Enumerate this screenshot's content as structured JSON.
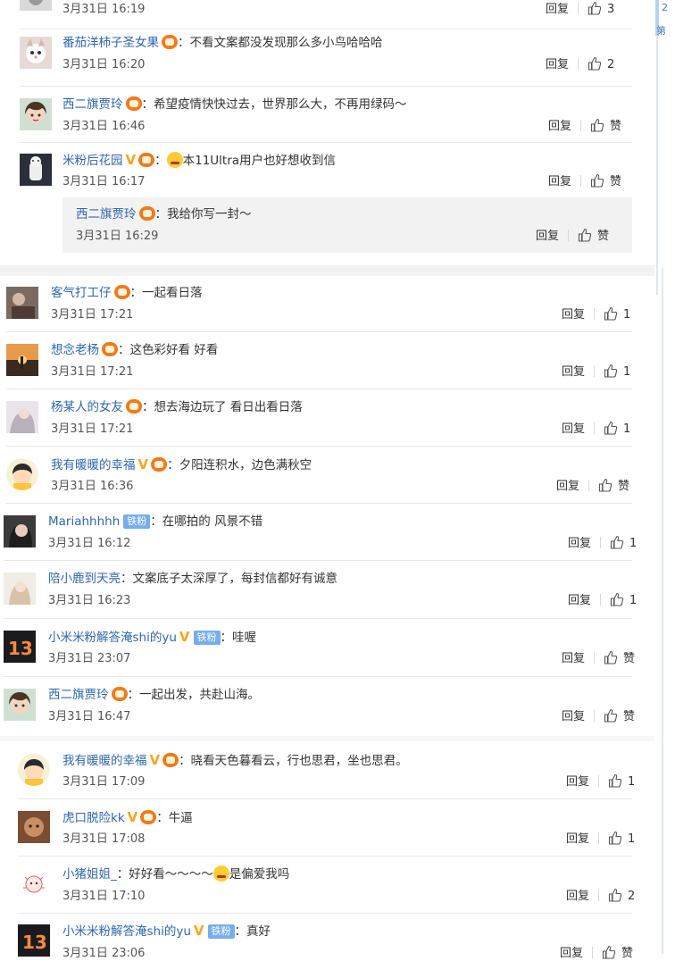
{
  "gutter": {
    "top": "2",
    "sub": "第"
  },
  "icons": {
    "like": "thumbs-up-icon",
    "fan_badge": "fan-level-badge-icon",
    "verified": "verified-v-icon"
  },
  "colors": {
    "username": "#2f67ad",
    "verified": "#f5a623",
    "fan_badge": "#f07b1d",
    "iron_fan": "#77aee8"
  },
  "labels": {
    "reply": "回复"
  },
  "threadA": [
    {
      "user": "",
      "text": "",
      "time": "3月31日 16:19",
      "likes": "3"
    },
    {
      "user": "番茄洋柿子圣女果",
      "sep": "：",
      "text": "不看文案都没发现那么多小鸟哈哈哈",
      "time": "3月31日 16:20",
      "likes": "2"
    },
    {
      "user": "西二旗贾玲",
      "sep": "：",
      "text": "希望疫情快快过去，世界那么大，不再用绿码～",
      "time": "3月31日 16:46",
      "likes": "赞"
    },
    {
      "user": "米粉后花园",
      "sep": "：",
      "text": "本11Ultra用户也好想收到信",
      "time": "3月31日 16:17",
      "likes": "赞"
    },
    {
      "user": "西二旗贾玲",
      "sep": "：",
      "text": "我给你写一封～",
      "time": "3月31日 16:29",
      "likes": "赞"
    }
  ],
  "threadB": [
    {
      "user": "客气打工仔",
      "sep": "：",
      "text": "一起看日落",
      "time": "3月31日 17:21",
      "likes": "1"
    },
    {
      "user": "想念老杨",
      "sep": "：",
      "text": "这色彩好看 好看",
      "time": "3月31日 17:21",
      "likes": "1"
    },
    {
      "user": "杨某人的女友",
      "sep": "：",
      "text": "想去海边玩了 看日出看日落",
      "time": "3月31日 17:21",
      "likes": "1"
    },
    {
      "user": "我有暖暖的幸福",
      "sep": "：",
      "text": "夕阳连积水，边色满秋空",
      "time": "3月31日 16:36",
      "likes": "赞"
    },
    {
      "user": "Mariahhhhh",
      "badge": "铁粉",
      "sep": "：",
      "text": "在哪拍的 风景不错",
      "time": "3月31日 16:12",
      "likes": "1"
    },
    {
      "user": "陪小鹿到天亮",
      "sep": "：",
      "text": "文案底子太深厚了，每封信都好有诚意",
      "time": "3月31日 16:23",
      "likes": "1"
    },
    {
      "user": "小米米粉解答淹shi的yu",
      "badge": "铁粉",
      "sep": "：",
      "text": "哇喔",
      "time": "3月31日 23:07",
      "likes": "赞"
    },
    {
      "user": "西二旗贾玲",
      "sep": "：",
      "text": "一起出发，共赴山海。",
      "time": "3月31日 16:47",
      "likes": "赞"
    }
  ],
  "threadC": [
    {
      "user": "我有暖暖的幸福",
      "sep": "：",
      "text": "晓看天色暮看云，行也思君，坐也思君。",
      "time": "3月31日 17:09",
      "likes": "1"
    },
    {
      "user": "虎口脱险kk",
      "sep": "：",
      "text": "牛逼",
      "time": "3月31日 17:08",
      "likes": "1"
    },
    {
      "user": "小猪姐姐_",
      "sep": "：",
      "text": "好好看～～～～",
      "text2": "是偏爱我吗",
      "time": "3月31日 17:10",
      "likes": "2"
    },
    {
      "user": "小米米粉解答淹shi的yu",
      "badge": "铁粉",
      "sep": "：",
      "text": "真好",
      "time": "3月31日 23:06",
      "likes": "赞"
    }
  ]
}
